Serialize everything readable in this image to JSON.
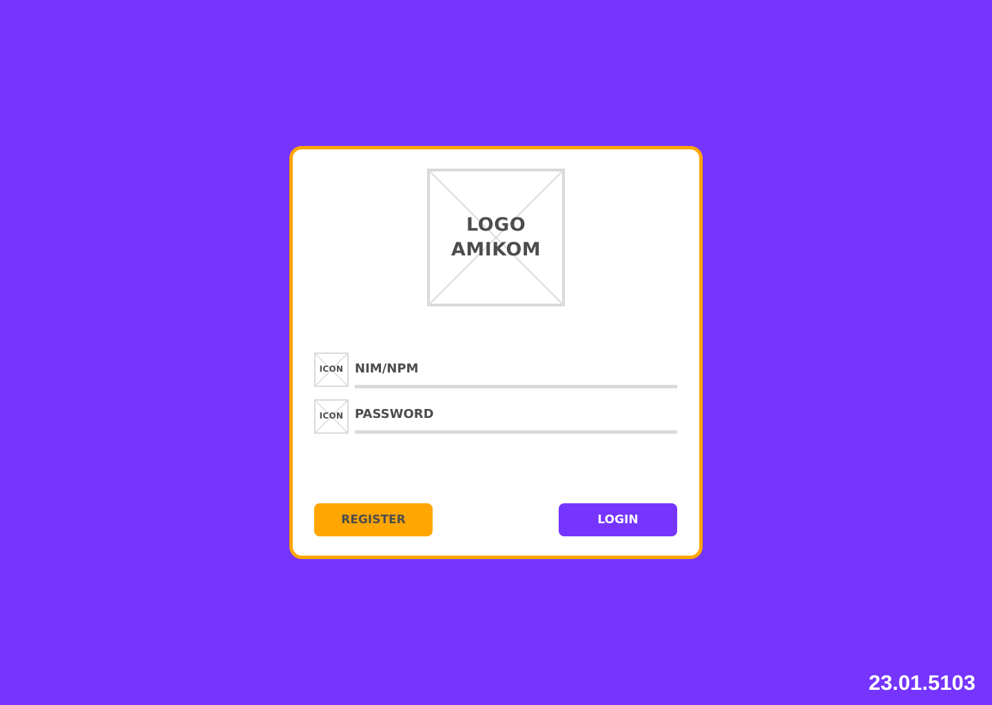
{
  "colors": {
    "background": "#7635FF",
    "card_border": "#FFA600",
    "card_background": "#FFFFFF",
    "placeholder_gray": "#D9D9D9",
    "text_dark": "#4D4D4D",
    "register_button": "#FFA600",
    "login_button": "#7635FF"
  },
  "logo": {
    "line1": "LOGO",
    "line2": "AMIKOM"
  },
  "form": {
    "nim_field": {
      "icon_label": "ICON",
      "placeholder": "NIM/NPM",
      "value": ""
    },
    "password_field": {
      "icon_label": "ICON",
      "placeholder": "PASSWORD",
      "value": ""
    }
  },
  "buttons": {
    "register_label": "REGISTER",
    "login_label": "LOGIN"
  },
  "footer": {
    "student_id": "23.01.5103"
  }
}
